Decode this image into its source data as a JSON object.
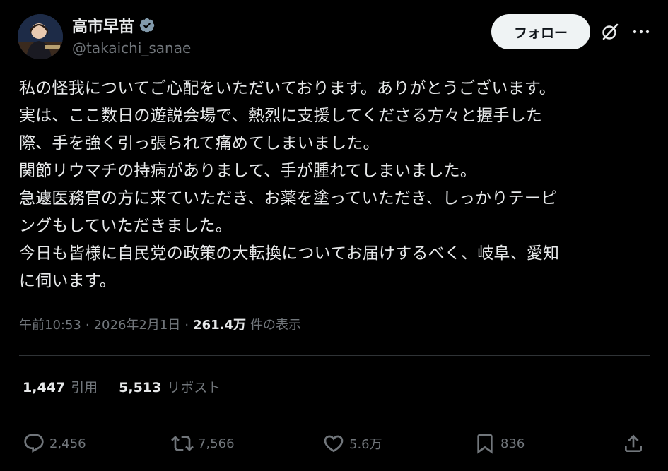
{
  "author": {
    "display_name": "高市早苗",
    "handle": "@takaichi_sanae",
    "verified_icon": "verified-badge-icon",
    "avatar_icon": "avatar"
  },
  "header": {
    "follow_label": "フォロー",
    "grok_icon": "grok-icon",
    "more_icon": "more-dots-icon"
  },
  "tweet": {
    "text": "私の怪我についてご心配をいただいております。ありがとうございます。\n実は、ここ数日の遊説会場で、熱烈に支援してくださる方々と握手した\n際、手を強く引っ張られて痛めてしまいました。\n関節リウマチの持病がありまして、手が腫れてしまいました。\n急遽医務官の方に来ていただき、お薬を塗っていただき、しっかりテーピ\nングもしていただきました。\n今日も皆様に自民党の政策の大転換についてお届けするべく、岐阜、愛知\nに伺います。",
    "time": "午前10:53",
    "separator": "·",
    "date": "2026年2月1日",
    "views_count": "261.4万",
    "views_label": "件の表示"
  },
  "stats": {
    "quotes_count": "1,447",
    "quotes_label": "引用",
    "reposts_count": "5,513",
    "reposts_label": "リポスト"
  },
  "actions": {
    "reply_count": "2,456",
    "repost_count": "7,566",
    "like_count": "5.6万",
    "bookmark_count": "836"
  },
  "colors": {
    "background": "#000000",
    "text_primary": "#e7e9ea",
    "text_secondary": "#71767b",
    "divider": "#2f3336",
    "verified": "#829aab",
    "button_bg": "#eff3f4"
  }
}
